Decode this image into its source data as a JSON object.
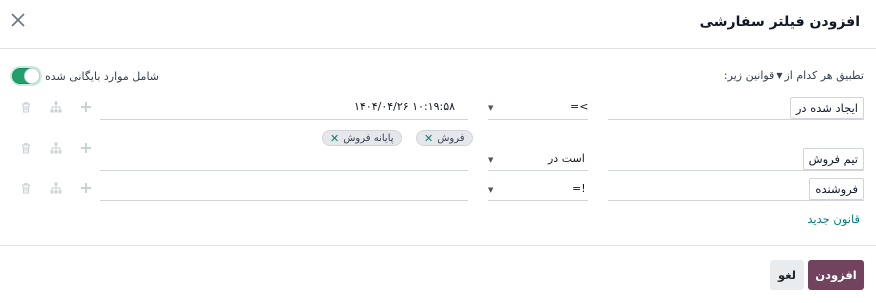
{
  "dialog": {
    "title": "افزودن فیلتر سفارشی",
    "close_icon": "close-icon"
  },
  "options": {
    "apply_label": "تطبیق هر کدام از",
    "apply_suffix": "قوانین زیر:",
    "archived_label": "شامل موارد بایگانی شده",
    "archived_on": true
  },
  "rules": [
    {
      "field": "ایجاد شده در",
      "operator": ">=",
      "value": "۱۴۰۴/۰۴/۲۶ ۱۰:۱۹:۵۸",
      "tags": []
    },
    {
      "field": "تیم فروش",
      "operator": "است در",
      "value": "",
      "tags": [
        "فروش",
        "پایانه فروش"
      ]
    },
    {
      "field": "فروشنده",
      "operator": "!=",
      "value": "",
      "tags": []
    }
  ],
  "new_rule_label": "قانون جدید",
  "footer": {
    "primary_label": "افزودن",
    "secondary_label": "لغو"
  },
  "colors": {
    "primary": "#71435e",
    "toggle": "#22a06b",
    "link": "#017e84"
  }
}
